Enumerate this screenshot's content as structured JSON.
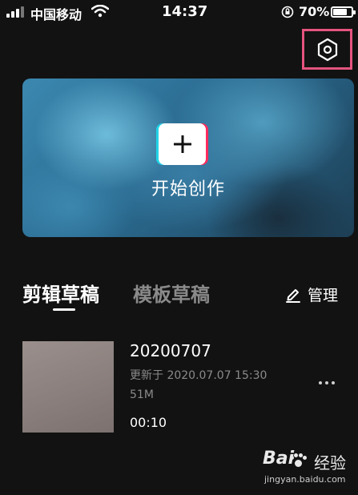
{
  "status_bar": {
    "carrier": "中国移动",
    "time": "14:37",
    "battery": "70%",
    "battery_level": 0.7
  },
  "header": {
    "settings_icon": "hexagon-settings-icon",
    "highlight_color": "#e5547f"
  },
  "banner": {
    "label": "开始创作",
    "icon": "plus-icon"
  },
  "tabs": [
    {
      "label": "剪辑草稿",
      "active": true
    },
    {
      "label": "模板草稿",
      "active": false
    }
  ],
  "manage": {
    "label": "管理",
    "icon": "edit-pen-icon"
  },
  "drafts": [
    {
      "title": "20200707",
      "updated": "更新于 2020.07.07 15:30",
      "size": "51M",
      "duration": "00:10"
    }
  ],
  "watermark": {
    "brand_a": "Bai",
    "brand_b": "经验",
    "url": "jingyan.baidu.com"
  }
}
